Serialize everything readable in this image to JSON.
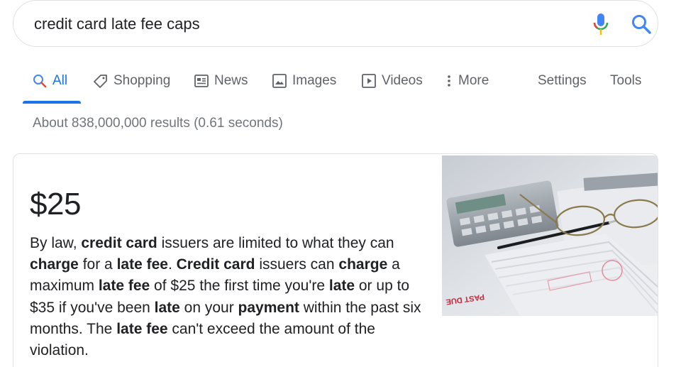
{
  "search": {
    "query": "credit card late fee caps"
  },
  "tabs": [
    {
      "label": "All",
      "icon": "search-icon",
      "active": true
    },
    {
      "label": "Shopping",
      "icon": "tag-icon",
      "active": false
    },
    {
      "label": "News",
      "icon": "newspaper-icon",
      "active": false
    },
    {
      "label": "Images",
      "icon": "image-icon",
      "active": false
    },
    {
      "label": "Videos",
      "icon": "play-icon",
      "active": false
    },
    {
      "label": "More",
      "icon": "more-vertical-icon",
      "active": false
    }
  ],
  "tools": {
    "settings_label": "Settings",
    "tools_label": "Tools"
  },
  "result_stats": "About 838,000,000 results (0.61 seconds)",
  "featured_snippet": {
    "answer": "$25",
    "text_segments": [
      {
        "text": "By law, ",
        "bold": false
      },
      {
        "text": "credit card",
        "bold": true
      },
      {
        "text": " issuers are limited to what they can ",
        "bold": false
      },
      {
        "text": "charge",
        "bold": true
      },
      {
        "text": " for a ",
        "bold": false
      },
      {
        "text": "late fee",
        "bold": true
      },
      {
        "text": ". ",
        "bold": false
      },
      {
        "text": "Credit card",
        "bold": true
      },
      {
        "text": " issuers can ",
        "bold": false
      },
      {
        "text": "charge",
        "bold": true
      },
      {
        "text": " a maximum ",
        "bold": false
      },
      {
        "text": "late fee",
        "bold": true
      },
      {
        "text": " of $25 the first time you're ",
        "bold": false
      },
      {
        "text": "late",
        "bold": true
      },
      {
        "text": " or up to $35 if you've been ",
        "bold": false
      },
      {
        "text": "late",
        "bold": true
      },
      {
        "text": " on your ",
        "bold": false
      },
      {
        "text": "payment",
        "bold": true
      },
      {
        "text": " within the past six months. The ",
        "bold": false
      },
      {
        "text": "late fee",
        "bold": true
      },
      {
        "text": " can't exceed the amount of the violation.",
        "bold": false
      }
    ],
    "image_stamp_text": "PAST DUE"
  },
  "colors": {
    "accent": "#1a73e8",
    "muted_text": "#5f6368",
    "stats_text": "#70757a",
    "border": "#dfe1e5"
  }
}
